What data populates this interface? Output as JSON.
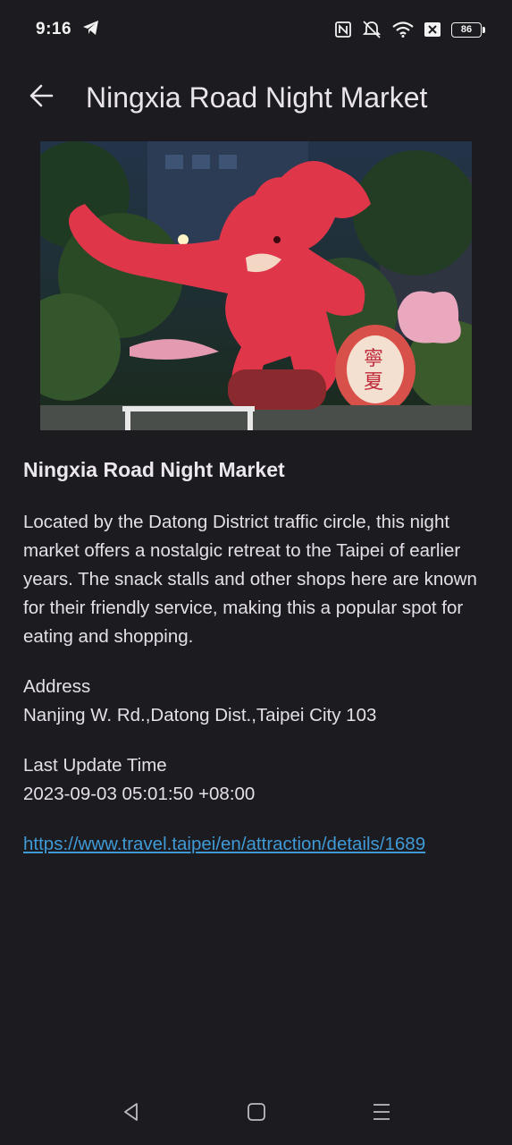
{
  "status_bar": {
    "time": "9:16",
    "battery_level": "86",
    "icons": [
      "telegram-icon",
      "nfc-icon",
      "mute-icon",
      "wifi-icon",
      "sim-off-icon",
      "battery-icon"
    ]
  },
  "app_bar": {
    "title": "Ningxia Road Night Market",
    "back_icon": "arrow-back-icon"
  },
  "hero_image": {
    "description_icon": "night-market-dragon-sculpture-image"
  },
  "detail": {
    "title": "Ningxia Road Night Market",
    "description": "Located by the Datong District traffic circle, this night market offers a nostalgic retreat to the Taipei of earlier years. The snack stalls and other shops here are known for their friendly service, making this a popular spot for eating and shopping.",
    "address_label": "Address",
    "address_value": "Nanjing W. Rd.,Datong Dist.,Taipei City 103",
    "update_label": "Last Update Time",
    "update_value": "2023-09-03 05:01:50 +08:00",
    "link": "https://www.travel.taipei/en/attraction/details/1689"
  },
  "nav_bar": {
    "back": "nav-back-icon",
    "home": "nav-home-icon",
    "recents": "nav-recents-icon"
  },
  "colors": {
    "background": "#1c1b20",
    "link": "#3f9ad6",
    "text": "#e4dfe8"
  }
}
